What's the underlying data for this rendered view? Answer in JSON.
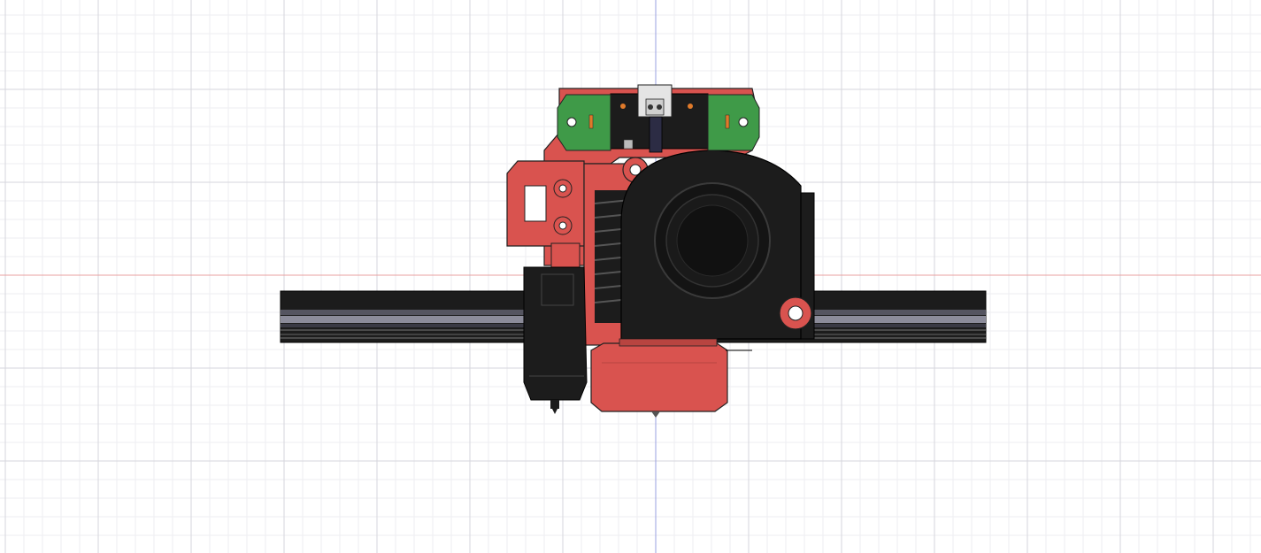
{
  "viewport": {
    "background": "#ffffff",
    "grid_minor_color": "#eeeef2",
    "grid_major_color": "#d6d6dc",
    "x_axis_color": "#e8a0a0",
    "y_axis_color": "#9aa0e0"
  },
  "model": {
    "plastic_color": "#d9534f",
    "plastic_dark": "#b84440",
    "black_part": "#1c1c1c",
    "rail_highlight": "#8c8c9a",
    "pcb_green": "#3f9a48",
    "icons": [
      "blower-fan-icon",
      "hotend-icon",
      "endstop-board-icon",
      "linear-rail-icon"
    ]
  }
}
